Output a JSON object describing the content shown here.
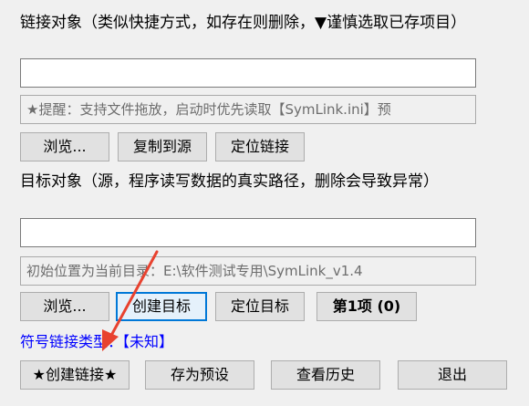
{
  "link_section": {
    "label": "链接对象（类似快捷方式，如存在则删除，▼谨慎选取已存项目）",
    "input_value": "",
    "hint": "★提醒：支持文件拖放，启动时优先读取【SymLink.ini】预",
    "buttons": {
      "browse": "浏览...",
      "copy_to_source": "复制到源",
      "locate_link": "定位链接"
    }
  },
  "target_section": {
    "label": "目标对象（源，程序读写数据的真实路径，删除会导致异常）",
    "input_value": "",
    "hint": "初始位置为当前目录：E:\\软件测试专用\\SymLink_v1.4",
    "buttons": {
      "browse": "浏览...",
      "create_target": "创建目标",
      "locate_target": "定位目标",
      "item_counter": "第1项 (0)"
    }
  },
  "link_type": {
    "label": "符号链接类型：",
    "value": "【未知】"
  },
  "actions": {
    "create_link": "★创建链接★",
    "save_preset": "存为预设",
    "view_history": "查看历史",
    "exit": "退出"
  },
  "colors": {
    "link_text": "#0000ff",
    "annotation_arrow": "#e8422f",
    "focus_border": "#0078d7"
  }
}
